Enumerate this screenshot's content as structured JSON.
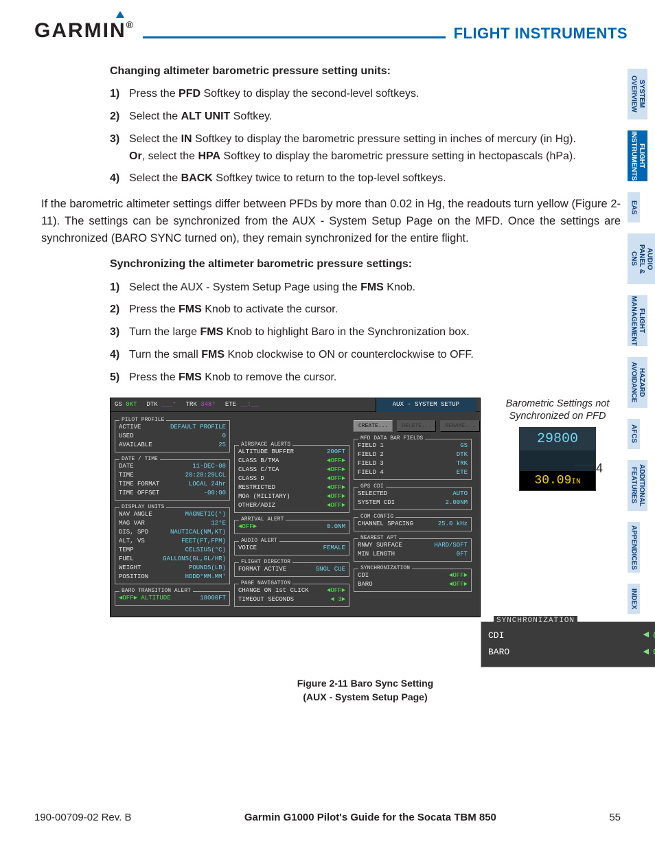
{
  "header": {
    "brand": "GARMIN",
    "section": "FLIGHT INSTRUMENTS"
  },
  "tabs": [
    "SYSTEM OVERVIEW",
    "FLIGHT INSTRUMENTS",
    "EAS",
    "AUDIO PANEL & CNS",
    "FLIGHT MANAGEMENT",
    "HAZARD AVOIDANCE",
    "AFCS",
    "ADDITIONAL FEATURES",
    "APPENDICES",
    "INDEX"
  ],
  "active_tab": 1,
  "proc1": {
    "title": "Changing altimeter barometric pressure setting units:",
    "steps": [
      {
        "n": "1)",
        "pre": "Press the ",
        "b": "PFD",
        "post": " Softkey to display the second-level softkeys."
      },
      {
        "n": "2)",
        "pre": "Select the ",
        "b": "ALT UNIT",
        "post": " Softkey."
      },
      {
        "n": "3)",
        "html": "Select the <b>IN</b> Softkey to display the barometric pressure setting in inches of mercury (in Hg).<br><b>Or</b>, select the <b>HPA</b> Softkey to display the barometric pressure setting in hectopascals (hPa)."
      },
      {
        "n": "4)",
        "pre": "Select the ",
        "b": "BACK",
        "post": " Softkey twice to return to the top-level softkeys."
      }
    ]
  },
  "para": "If the barometric altimeter settings differ between PFDs by more than 0.02 in Hg, the readouts turn yellow (Figure 2-11).  The settings can be synchronized from the AUX - System Setup Page on the MFD.  Once the settings are synchronized (BARO SYNC turned on), they remain synchronized for the entire flight.",
  "proc2": {
    "title": "Synchronizing the altimeter barometric pressure settings:",
    "steps": [
      {
        "n": "1)",
        "pre": "Select the AUX - System Setup Page using the ",
        "b": "FMS",
        "post": " Knob."
      },
      {
        "n": "2)",
        "pre": "Press the ",
        "b": "FMS",
        "post": " Knob to activate the cursor."
      },
      {
        "n": "3)",
        "pre": "Turn the large ",
        "b": "FMS",
        "post": " Knob to highlight Baro in the Synchronization box."
      },
      {
        "n": "4)",
        "pre": "Turn the small ",
        "b": "FMS",
        "post": " Knob clockwise to ON or counterclockwise to OFF."
      },
      {
        "n": "5)",
        "pre": "Press the ",
        "b": "FMS",
        "post": " Knob to remove the cursor."
      }
    ]
  },
  "mfd": {
    "top": {
      "gs_lbl": "GS",
      "gs": "0KT",
      "dtk_lbl": "DTK",
      "dtk": "___°",
      "trk_lbl": "TRK",
      "trk": "348°",
      "ete_lbl": "ETE",
      "ete": "__:__",
      "title": "AUX - SYSTEM SETUP"
    },
    "pilot": {
      "title": "PILOT PROFILE",
      "rows": [
        [
          "ACTIVE",
          "DEFAULT PROFILE"
        ],
        [
          "USED",
          "0"
        ],
        [
          "AVAILABLE",
          "25"
        ]
      ],
      "buttons": [
        "CREATE...",
        "DELETE...",
        "RENAME..."
      ]
    },
    "date": {
      "title": "DATE / TIME",
      "rows": [
        [
          "DATE",
          "11-DEC-08"
        ],
        [
          "TIME",
          "20:28:29LCL"
        ],
        [
          "TIME FORMAT",
          "LOCAL 24hr"
        ],
        [
          "TIME OFFSET",
          "-00:00"
        ]
      ]
    },
    "disp": {
      "title": "DISPLAY UNITS",
      "rows": [
        [
          "NAV ANGLE",
          "MAGNETIC(°)"
        ],
        [
          "MAG VAR",
          "12°E"
        ],
        [
          "DIS, SPD",
          "NAUTICAL(NM,KT)"
        ],
        [
          "ALT, VS",
          "FEET(FT,FPM)"
        ],
        [
          "TEMP",
          "CELSIUS(°C)"
        ],
        [
          "FUEL",
          "GALLONS(GL,GL/HR)"
        ],
        [
          "WEIGHT",
          "POUNDS(LB)"
        ],
        [
          "POSITION",
          "HDDD°MM.MM'"
        ]
      ]
    },
    "baro_t": {
      "title": "BARO TRANSITION ALERT",
      "row": [
        "◄OFF►  ALTITUDE",
        "18000FT"
      ]
    },
    "air": {
      "title": "AIRSPACE ALERTS",
      "rows": [
        [
          "ALTITUDE BUFFER",
          "200FT"
        ],
        [
          "CLASS B/TMA",
          "◄OFF►"
        ],
        [
          "CLASS C/TCA",
          "◄OFF►"
        ],
        [
          "CLASS D",
          "◄OFF►"
        ],
        [
          "RESTRICTED",
          "◄OFF►"
        ],
        [
          "MOA (MILITARY)",
          "◄OFF►"
        ],
        [
          "OTHER/ADIZ",
          "◄OFF►"
        ]
      ]
    },
    "arr": {
      "title": "ARRIVAL ALERT",
      "row": [
        "◄OFF►",
        "0.0NM"
      ]
    },
    "aud": {
      "title": "AUDIO ALERT",
      "row": [
        "VOICE",
        "FEMALE"
      ]
    },
    "fd": {
      "title": "FLIGHT DIRECTOR",
      "row": [
        "FORMAT ACTIVE",
        "SNGL CUE"
      ]
    },
    "pnav": {
      "title": "PAGE NAVIGATION",
      "rows": [
        [
          "CHANGE ON 1st CLICK",
          "◄OFF►"
        ],
        [
          "TIMEOUT SECONDS",
          "◄ 3►"
        ]
      ]
    },
    "bar": {
      "title": "MFD DATA BAR FIELDS",
      "rows": [
        [
          "FIELD 1",
          "GS"
        ],
        [
          "FIELD 2",
          "DTK"
        ],
        [
          "FIELD 3",
          "TRK"
        ],
        [
          "FIELD 4",
          "ETE"
        ]
      ]
    },
    "gps": {
      "title": "GPS CDI",
      "rows": [
        [
          "SELECTED",
          "AUTO"
        ],
        [
          "SYSTEM CDI",
          "2.00NM"
        ]
      ]
    },
    "com": {
      "title": "COM CONFIG",
      "row": [
        "CHANNEL SPACING",
        "25.0 kHz"
      ]
    },
    "apt": {
      "title": "NEAREST APT",
      "rows": [
        [
          "RNWY SURFACE",
          "HARD/SOFT"
        ],
        [
          "MIN LENGTH",
          "0FT"
        ]
      ]
    },
    "sync": {
      "title": "SYNCHRONIZATION",
      "rows": [
        [
          "CDI",
          "◄OFF►"
        ],
        [
          "BARO",
          "◄OFF►"
        ]
      ]
    }
  },
  "callout": {
    "note": "Barometric Settings not Synchronized on PFD",
    "main": "29800",
    "yellow": "30.09",
    "yellow_unit": "IN",
    "num": "4"
  },
  "sync_big": {
    "title": "SYNCHRONIZATION",
    "rows": [
      [
        "CDI",
        "OFF"
      ],
      [
        "BARO",
        "OFF"
      ]
    ]
  },
  "caption": {
    "l1": "Figure 2-11  Baro Sync Setting",
    "l2": "(AUX - System Setup Page)"
  },
  "footer": {
    "left": "190-00709-02  Rev. B",
    "mid": "Garmin G1000 Pilot's Guide for the Socata TBM 850",
    "right": "55"
  }
}
